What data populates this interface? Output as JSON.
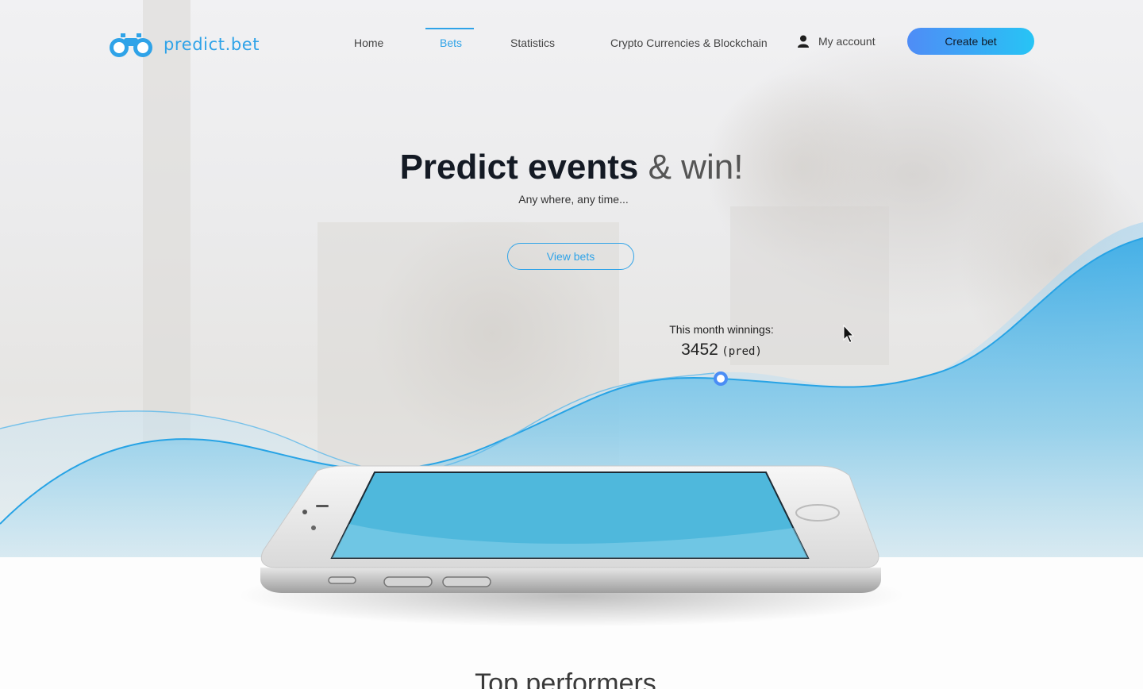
{
  "brand": {
    "name": "predict.bet",
    "logo_icon": "binoculars-icon",
    "accent": "#2fa3e8"
  },
  "nav": {
    "items": [
      {
        "label": "Home",
        "active": false
      },
      {
        "label": "Bets",
        "active": true
      },
      {
        "label": "Statistics",
        "active": false
      },
      {
        "label": "Crypto Currencies & Blockchain",
        "active": false
      }
    ],
    "account_label": "My account",
    "account_icon": "user-icon",
    "create_label": "Create bet"
  },
  "hero": {
    "headline_strong": "Predict events",
    "headline_light": "& win!",
    "subline": "Any where, any time...",
    "cta_label": "View bets",
    "winnings_label": "This month winnings:",
    "winnings_value": "3452",
    "winnings_unit": "(pred)"
  },
  "section": {
    "title": "Top performers"
  },
  "colors": {
    "accent": "#2fa3e8",
    "button_from": "#4f8cf6",
    "button_to": "#27c4f5",
    "screen": "#4fb8dc"
  }
}
